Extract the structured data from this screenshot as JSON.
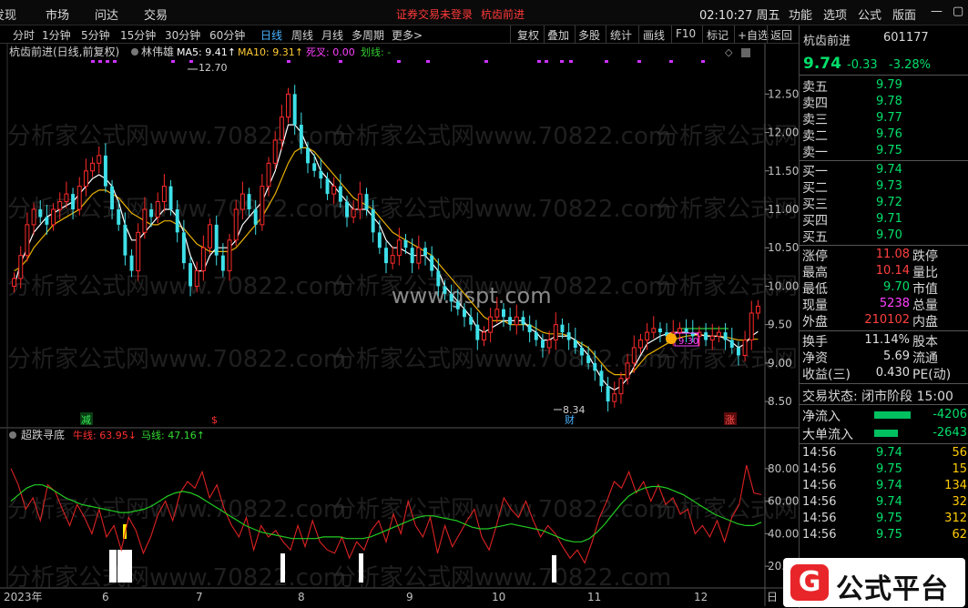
{
  "menubar": {
    "items": [
      "发现",
      "市场",
      "问达",
      "交易"
    ],
    "status": "证券交易未登录",
    "stock_title": "杭齿前进",
    "clock": "02:10:27 周五",
    "right_items": [
      "功能",
      "选项",
      "公式",
      "版面"
    ]
  },
  "periods": {
    "items": [
      "分时",
      "1分钟",
      "5分钟",
      "15分钟",
      "30分钟",
      "60分钟",
      "日线",
      "周线",
      "月线",
      "多周期",
      "更多>"
    ],
    "active": "日线",
    "tools": [
      "复权",
      "叠加",
      "多股",
      "统计",
      "画线",
      "F10",
      "标记",
      "+自选",
      "返回"
    ]
  },
  "main_chart": {
    "title": "杭齿前进(日线,前复权)",
    "indicator": "林伟雄",
    "ma5": "MA5: 9.41↑",
    "ma10": "MA10: 9.31↑",
    "dead": "死叉: 0.00",
    "draw": "划线: -",
    "high_label": "12.70",
    "low_label": "8.34",
    "watermark_center": "www.gspt.com",
    "watermark": "分析家公式网www.70822.com",
    "price_box_label": "9.30",
    "marker_jian": "减",
    "marker_s": "$",
    "marker_cai": "财",
    "marker_zhang": "涨"
  },
  "sub_chart": {
    "title": "超跌寻底",
    "niu": "牛线: 63.95↓",
    "ma": "马线: 47.16↑"
  },
  "xaxis": [
    "2023年",
    "6",
    "7",
    "8",
    "9",
    "10",
    "11",
    "12",
    "日"
  ],
  "chart_data": [
    {
      "type": "candlestick",
      "title": "杭齿前进(日线,前复权)",
      "ylim": [
        8.3,
        12.8
      ],
      "yticks": [
        "12.50",
        "12.00",
        "11.50",
        "11.00",
        "10.50",
        "10.00",
        "9.50",
        "9.00",
        "8.50"
      ],
      "xlabels": [
        "2023年",
        "6",
        "7",
        "8",
        "9",
        "10",
        "11",
        "12"
      ],
      "close": [
        10.1,
        10.4,
        10.8,
        11.0,
        10.9,
        10.8,
        11.0,
        11.1,
        11.2,
        11.0,
        11.3,
        11.5,
        11.6,
        11.7,
        11.3,
        11.0,
        10.8,
        10.4,
        10.2,
        10.7,
        11.0,
        10.9,
        11.1,
        11.3,
        11.0,
        10.7,
        10.3,
        10.0,
        10.2,
        10.5,
        10.8,
        10.4,
        10.2,
        10.6,
        11.0,
        11.2,
        11.0,
        10.8,
        11.3,
        11.6,
        11.9,
        12.2,
        12.5,
        12.1,
        11.8,
        11.6,
        11.5,
        11.4,
        11.2,
        11.3,
        11.1,
        10.9,
        11.0,
        11.2,
        11.0,
        10.7,
        10.5,
        10.3,
        10.4,
        10.6,
        10.5,
        10.3,
        10.5,
        10.4,
        10.2,
        10.0,
        9.9,
        9.8,
        9.7,
        9.6,
        9.5,
        9.3,
        9.4,
        9.6,
        9.7,
        9.6,
        9.5,
        9.6,
        9.5,
        9.4,
        9.3,
        9.2,
        9.3,
        9.5,
        9.4,
        9.3,
        9.2,
        9.1,
        9.0,
        8.9,
        8.7,
        8.5,
        8.6,
        8.8,
        9.0,
        9.2,
        9.3,
        9.4,
        9.45,
        9.4,
        9.35,
        9.4,
        9.45,
        9.4,
        9.35,
        9.4,
        9.3,
        9.35,
        9.4,
        9.3,
        9.2,
        9.1,
        9.3,
        9.65,
        9.74
      ],
      "ma5": [
        10.0,
        10.3,
        10.5,
        10.7,
        10.8,
        10.9,
        10.95,
        11.0,
        11.05,
        11.1,
        11.2,
        11.3,
        11.4,
        11.45,
        11.4,
        11.3,
        11.1,
        10.8,
        10.6,
        10.6,
        10.7,
        10.8,
        10.9,
        11.0,
        11.0,
        10.9,
        10.7,
        10.4,
        10.2,
        10.2,
        10.4,
        10.5,
        10.5,
        10.5,
        10.6,
        10.8,
        10.9,
        11.0,
        11.1,
        11.3,
        11.5,
        11.8,
        12.1,
        12.1,
        12.0,
        11.8,
        11.7,
        11.5,
        11.4,
        11.3,
        11.2,
        11.1,
        11.0,
        11.0,
        11.0,
        10.9,
        10.8,
        10.6,
        10.5,
        10.5,
        10.45,
        10.4,
        10.4,
        10.4,
        10.3,
        10.2,
        10.0,
        9.9,
        9.8,
        9.7,
        9.6,
        9.45,
        9.4,
        9.45,
        9.5,
        9.55,
        9.55,
        9.55,
        9.55,
        9.45,
        9.4,
        9.3,
        9.3,
        9.35,
        9.35,
        9.35,
        9.3,
        9.2,
        9.1,
        8.95,
        8.8,
        8.7,
        8.65,
        8.7,
        8.8,
        8.95,
        9.1,
        9.25,
        9.3,
        9.35,
        9.38,
        9.4,
        9.4,
        9.4,
        9.38,
        9.37,
        9.35,
        9.35,
        9.35,
        9.32,
        9.27,
        9.2,
        9.25,
        9.35,
        9.41
      ],
      "ma10": [
        10.2,
        10.25,
        10.35,
        10.5,
        10.6,
        10.7,
        10.8,
        10.85,
        10.9,
        10.95,
        11.0,
        11.1,
        11.2,
        11.25,
        11.25,
        11.2,
        11.15,
        11.05,
        10.95,
        10.9,
        10.85,
        10.8,
        10.8,
        10.85,
        10.85,
        10.8,
        10.75,
        10.65,
        10.55,
        10.5,
        10.45,
        10.45,
        10.45,
        10.45,
        10.5,
        10.6,
        10.7,
        10.8,
        10.9,
        11.05,
        11.2,
        11.4,
        11.6,
        11.75,
        11.8,
        11.8,
        11.75,
        11.65,
        11.55,
        11.45,
        11.35,
        11.25,
        11.15,
        11.1,
        11.05,
        11.0,
        10.9,
        10.8,
        10.7,
        10.65,
        10.6,
        10.55,
        10.5,
        10.45,
        10.4,
        10.3,
        10.2,
        10.1,
        10.0,
        9.9,
        9.8,
        9.7,
        9.6,
        9.55,
        9.55,
        9.55,
        9.5,
        9.5,
        9.5,
        9.5,
        9.45,
        9.4,
        9.38,
        9.38,
        9.38,
        9.35,
        9.3,
        9.25,
        9.2,
        9.1,
        9.0,
        8.9,
        8.85,
        8.85,
        8.85,
        8.9,
        9.0,
        9.1,
        9.15,
        9.2,
        9.25,
        9.3,
        9.33,
        9.35,
        9.36,
        9.37,
        9.36,
        9.35,
        9.35,
        9.34,
        9.32,
        9.3,
        9.3,
        9.31,
        9.31
      ]
    },
    {
      "type": "line",
      "title": "超跌寻底",
      "ylim": [
        10,
        95
      ],
      "yticks": [
        "80.00",
        "60.00",
        "40.00",
        "20.00"
      ],
      "series": [
        {
          "name": "牛线",
          "values": [
            80,
            70,
            55,
            62,
            48,
            70,
            66,
            55,
            45,
            58,
            50,
            40,
            55,
            38,
            45,
            30,
            50,
            42,
            28,
            38,
            52,
            60,
            48,
            65,
            72,
            68,
            78,
            62,
            70,
            55,
            45,
            38,
            50,
            30,
            45,
            38,
            42,
            35,
            30,
            45,
            32,
            48,
            35,
            30,
            28,
            38,
            25,
            35,
            30,
            42,
            48,
            35,
            52,
            40,
            60,
            45,
            38,
            50,
            28,
            45,
            32,
            40,
            48,
            55,
            38,
            30,
            45,
            62,
            55,
            50,
            60,
            48,
            38,
            45,
            40,
            32,
            25,
            30,
            22,
            35,
            50,
            60,
            72,
            68,
            78,
            65,
            72,
            60,
            70,
            58,
            62,
            52,
            55,
            40,
            45,
            38,
            48,
            35,
            50,
            58,
            82,
            65,
            64
          ]
        },
        {
          "name": "马线",
          "values": [
            60,
            64,
            68,
            70,
            70,
            68,
            65,
            62,
            60,
            58,
            57,
            56,
            55,
            54,
            53,
            53,
            54,
            55,
            57,
            60,
            63,
            65,
            66,
            65,
            63,
            60,
            57,
            54,
            51,
            48,
            45,
            43,
            41,
            40,
            39,
            38,
            37,
            37,
            37,
            37,
            38,
            38,
            38,
            37,
            37,
            37,
            38,
            40,
            42,
            44,
            46,
            48,
            50,
            51,
            51,
            50,
            49,
            48,
            46,
            44,
            43,
            43,
            44,
            45,
            46,
            45,
            44,
            43,
            42,
            40,
            38,
            36,
            35,
            35,
            37,
            41,
            46,
            52,
            58,
            63,
            66,
            68,
            69,
            69,
            68,
            66,
            64,
            61,
            58,
            55,
            52,
            50,
            48,
            46,
            45,
            45,
            47
          ]
        }
      ]
    }
  ],
  "right_panel": {
    "name": "杭齿前进",
    "code": "601177",
    "price": "9.74",
    "change": "-0.33",
    "pct": "-3.28%",
    "sell": [
      {
        "label": "卖五",
        "price": "9.79"
      },
      {
        "label": "卖四",
        "price": "9.78"
      },
      {
        "label": "卖三",
        "price": "9.77"
      },
      {
        "label": "卖二",
        "price": "9.76"
      },
      {
        "label": "卖一",
        "price": "9.75"
      }
    ],
    "buy": [
      {
        "label": "买一",
        "price": "9.74"
      },
      {
        "label": "买二",
        "price": "9.73"
      },
      {
        "label": "买三",
        "price": "9.72"
      },
      {
        "label": "买四",
        "price": "9.71"
      },
      {
        "label": "买五",
        "price": "9.70"
      }
    ],
    "stats": [
      {
        "l1": "涨停",
        "v1": "11.08",
        "c1": "#ff4040",
        "l2": "跌停"
      },
      {
        "l1": "最高",
        "v1": "10.14",
        "c1": "#ff4040",
        "l2": "量比"
      },
      {
        "l1": "最低",
        "v1": "9.70",
        "c1": "#00e06a",
        "l2": "市值"
      },
      {
        "l1": "现量",
        "v1": "5238",
        "c1": "#ff40ff",
        "l2": "总量"
      },
      {
        "l1": "外盘",
        "v1": "210102",
        "c1": "#ff4040",
        "l2": "内盘"
      }
    ],
    "stats2": [
      {
        "l1": "换手",
        "v1": "11.14%",
        "c1": "#e0e0e0",
        "l2": "股本"
      },
      {
        "l1": "净资",
        "v1": "5.69",
        "c1": "#e0e0e0",
        "l2": "流通"
      },
      {
        "l1": "收益(三)",
        "v1": "0.430",
        "c1": "#e0e0e0",
        "l2": "PE(动)"
      }
    ],
    "trade_state": "交易状态: 闭市阶段 15:00",
    "funds": [
      {
        "label": "净流入",
        "value": "-4206"
      },
      {
        "label": "大单流入",
        "value": "-2643"
      }
    ],
    "ticks": [
      {
        "time": "14:56",
        "price": "9.74",
        "vol": "56"
      },
      {
        "time": "14:56",
        "price": "9.75",
        "vol": "15"
      },
      {
        "time": "14:56",
        "price": "9.74",
        "vol": "134"
      },
      {
        "time": "14:56",
        "price": "9.74",
        "vol": "32"
      },
      {
        "time": "14:56",
        "price": "9.75",
        "vol": "312"
      },
      {
        "time": "14:56",
        "price": "9.75",
        "vol": "62"
      }
    ]
  },
  "logo": {
    "text": "公式平台",
    "letter": "G"
  }
}
